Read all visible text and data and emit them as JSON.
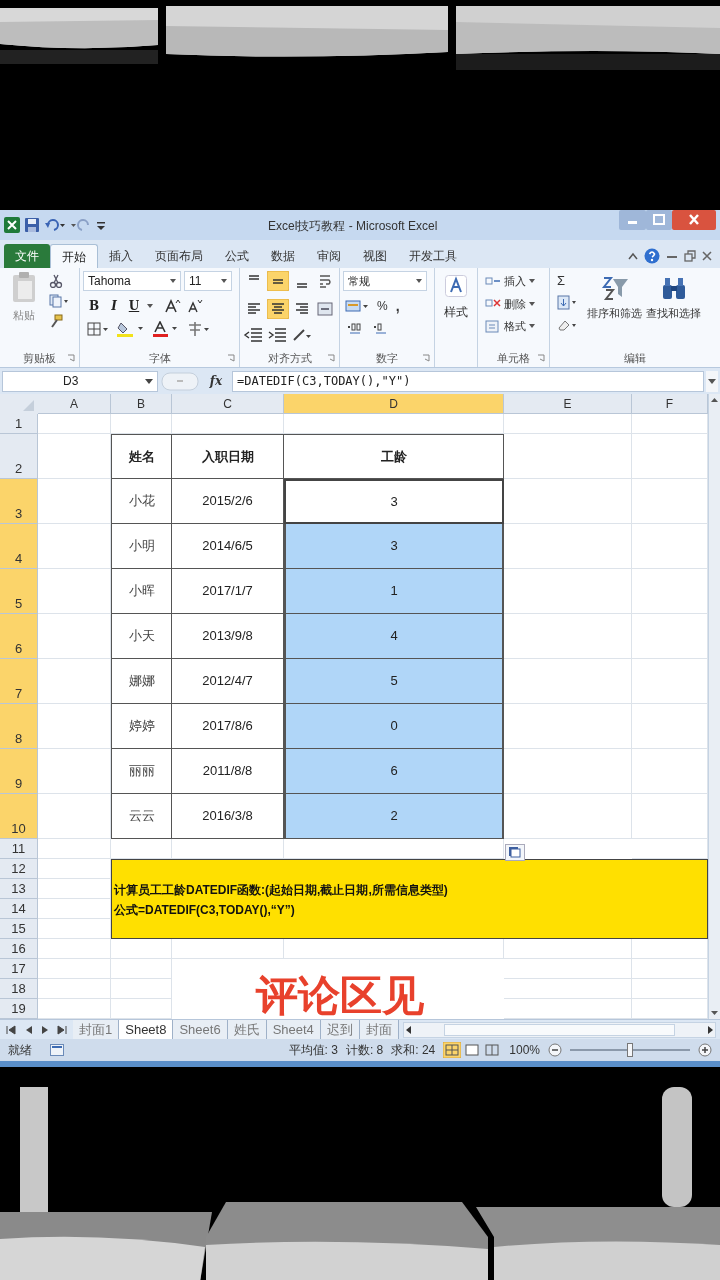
{
  "window": {
    "title": "Excel技巧教程 - Microsoft Excel"
  },
  "ribbon_tabs": [
    {
      "label": "文件",
      "kind": "file",
      "selected": false
    },
    {
      "label": "开始",
      "kind": "tab",
      "selected": true
    },
    {
      "label": "插入",
      "kind": "tab",
      "selected": false
    },
    {
      "label": "页面布局",
      "kind": "tab",
      "selected": false
    },
    {
      "label": "公式",
      "kind": "tab",
      "selected": false
    },
    {
      "label": "数据",
      "kind": "tab",
      "selected": false
    },
    {
      "label": "审阅",
      "kind": "tab",
      "selected": false
    },
    {
      "label": "视图",
      "kind": "tab",
      "selected": false
    },
    {
      "label": "开发工具",
      "kind": "tab",
      "selected": false
    }
  ],
  "ribbon": {
    "clipboard": {
      "paste": "粘贴",
      "label": "剪贴板"
    },
    "font": {
      "name": "Tahoma",
      "size": "11",
      "bold": "B",
      "italic": "I",
      "underline": "U",
      "label": "字体"
    },
    "alignment": {
      "label": "对齐方式",
      "buttons": [
        {
          "kind": "top",
          "selected": false
        },
        {
          "kind": "middle",
          "selected": true
        },
        {
          "kind": "bottom",
          "selected": false
        },
        {
          "kind": "wrap",
          "selected": false
        },
        {
          "kind": "left",
          "selected": false
        },
        {
          "kind": "center",
          "selected": true
        },
        {
          "kind": "right",
          "selected": false
        },
        {
          "kind": "merge",
          "selected": false
        }
      ]
    },
    "number": {
      "format": "常规",
      "percent": "%",
      "comma": ",",
      "label": "数字"
    },
    "styles": {
      "button": "样式"
    },
    "cells": {
      "items": [
        "插入",
        "删除",
        "格式"
      ],
      "label": "单元格"
    },
    "editing": {
      "sigma": "Σ",
      "sort": "排序和筛选",
      "find": "查找和选择",
      "label": "编辑"
    }
  },
  "formula_bar": {
    "name_box": "D3",
    "fx": "fx",
    "formula": "=DATEDIF(C3,TODAY(),\"Y\")"
  },
  "columns": [
    {
      "label": "A",
      "selected": false
    },
    {
      "label": "B",
      "selected": false
    },
    {
      "label": "C",
      "selected": false
    },
    {
      "label": "D",
      "selected": true
    },
    {
      "label": "E",
      "selected": false
    },
    {
      "label": "F",
      "selected": false
    }
  ],
  "row_headers": [
    {
      "label": "1",
      "selected": false
    },
    {
      "label": "2",
      "selected": false
    },
    {
      "label": "3",
      "selected": true
    },
    {
      "label": "4",
      "selected": true
    },
    {
      "label": "5",
      "selected": true
    },
    {
      "label": "6",
      "selected": true
    },
    {
      "label": "7",
      "selected": true
    },
    {
      "label": "8",
      "selected": true
    },
    {
      "label": "9",
      "selected": true
    },
    {
      "label": "10",
      "selected": true
    },
    {
      "label": "11",
      "selected": false
    },
    {
      "label": "12",
      "selected": false
    },
    {
      "label": "13",
      "selected": false
    },
    {
      "label": "14",
      "selected": false
    },
    {
      "label": "15",
      "selected": false
    },
    {
      "label": "16",
      "selected": false
    },
    {
      "label": "17",
      "selected": false
    },
    {
      "label": "18",
      "selected": false
    },
    {
      "label": "19",
      "selected": false
    }
  ],
  "table": {
    "header": [
      "姓名",
      "入职日期",
      "工龄"
    ],
    "rows": [
      {
        "name": "小花",
        "date": "2015/2/6",
        "years": "3",
        "selected": true,
        "active": true
      },
      {
        "name": "小明",
        "date": "2014/6/5",
        "years": "3",
        "selected": true,
        "active": false
      },
      {
        "name": "小晖",
        "date": "2017/1/7",
        "years": "1",
        "selected": true,
        "active": false
      },
      {
        "name": "小天",
        "date": "2013/9/8",
        "years": "4",
        "selected": true,
        "active": false
      },
      {
        "name": "娜娜",
        "date": "2012/4/7",
        "years": "5",
        "selected": true,
        "active": false
      },
      {
        "name": "婷婷",
        "date": "2017/8/6",
        "years": "0",
        "selected": true,
        "active": false
      },
      {
        "name": "丽丽",
        "date": "2011/8/8",
        "years": "6",
        "selected": true,
        "active": false
      },
      {
        "name": "云云",
        "date": "2016/3/8",
        "years": "2",
        "selected": true,
        "active": false
      }
    ]
  },
  "note": {
    "lines": [
      "计算员工工龄DATEDIF函数:(起始日期,截止日期,所需信息类型)",
      "公式=DATEDIF(C3,TODAY(),“Y”)"
    ]
  },
  "overlay_caption": "评论区见",
  "sheet_tabs": [
    {
      "label": "封面1",
      "selected": false
    },
    {
      "label": "Sheet8",
      "selected": true
    },
    {
      "label": "Sheet6",
      "selected": false
    },
    {
      "label": "姓氏",
      "selected": false
    },
    {
      "label": "Sheet4",
      "selected": false
    },
    {
      "label": "迟到",
      "selected": false
    },
    {
      "label": "封面",
      "selected": false
    }
  ],
  "status_bar": {
    "mode": "就绪",
    "stats": [
      "平均值: 3",
      "计数: 8",
      "求和: 24"
    ],
    "zoom": "100%",
    "zoom_level": {
      "level": 0.5
    }
  }
}
